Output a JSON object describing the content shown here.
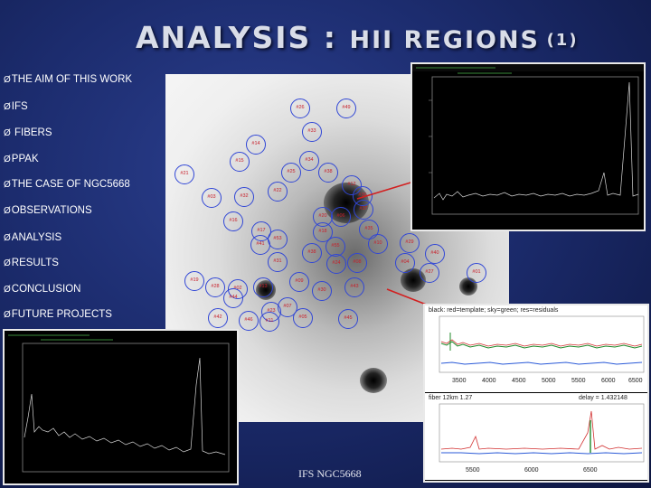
{
  "slide": {
    "title_main": "ANALYSIS : ",
    "title_sub": "HII REGIONS",
    "title_paren": "(1)",
    "footer": "IFS NGC5668"
  },
  "bullets": [
    {
      "label": "THE AIM OF THIS WORK"
    },
    {
      "label": "IFS"
    },
    {
      "label": " FIBERS"
    },
    {
      "label": "PPAK"
    },
    {
      "label": "THE CASE OF NGC5668"
    },
    {
      "label": "OBSERVATIONS"
    },
    {
      "label": "ANALYSIS"
    },
    {
      "label": "RESULTS"
    },
    {
      "label": "CONCLUSION"
    },
    {
      "label": "FUTURE PROJECTS"
    }
  ],
  "bullet_arrow": "Ø",
  "fibers": [
    "#26",
    "#49",
    "#33",
    "#14",
    "#15",
    "#34",
    "#25",
    "#21",
    "#38",
    "#22",
    "#32",
    "#12",
    "#03",
    "#36",
    "#16",
    "#20",
    "#06",
    "#37",
    "#17",
    "#53",
    "#41",
    "#18",
    "#35",
    "#38",
    "#55",
    "#10",
    "#29",
    "#40",
    "#31",
    "#24",
    "#08",
    "#04",
    "#27",
    "#01",
    "#19",
    "#28",
    "#02",
    "#13",
    "#09",
    "#30",
    "#43",
    "#44",
    "#23",
    "#07",
    "#42",
    "#46",
    "#11",
    "#05",
    "#45"
  ],
  "bottom_right_plot": {
    "caption": "black: red=template; sky=green; res=residuals",
    "x_ticks_top": [
      "3500",
      "4000",
      "4500",
      "5000",
      "5500",
      "6000",
      "6500"
    ],
    "x_ticks_bottom": [
      "5500",
      "6000",
      "6500"
    ],
    "meta_left": "fiber 12km 1.27",
    "meta_right": "delay = 1.432148"
  },
  "colors": {
    "background": "#1c2c6e",
    "title": "#d9dde8",
    "bullet_text": "#ffffff",
    "fiber_circle": "#3046d6",
    "fiber_label": "#c8202a",
    "leader_line": "#d21f1f"
  }
}
